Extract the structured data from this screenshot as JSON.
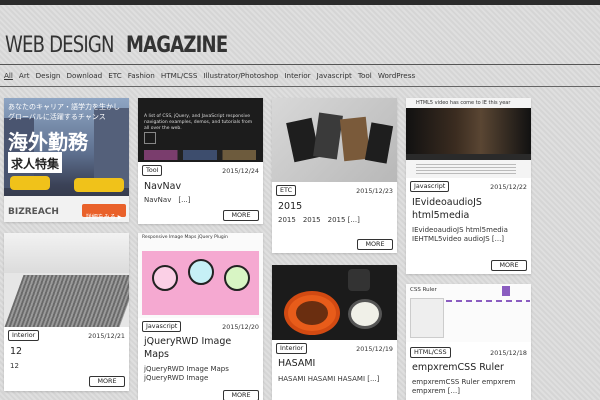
{
  "site": {
    "logo_light": "WEB DESIGN",
    "logo_bold": "MAGAZINE"
  },
  "nav": [
    "All",
    "Art",
    "Design",
    "Download",
    "ETC",
    "Fashion",
    "HTML/CSS",
    "Illustrator/Photoshop",
    "Interior",
    "Javascript",
    "Tool",
    "WordPress"
  ],
  "ad": {
    "line1": "あなたのキャリア・語学力を生かし",
    "line2": "グローバルに活躍するチャンス",
    "headline": "海外勤務",
    "sub": "求人特集",
    "brand": "BIZREACH",
    "cta": "詳細をみる ▶"
  },
  "posts": {
    "navnav": {
      "tag": "Tool",
      "date": "2015/12/24",
      "title": "NavNav",
      "excerpt": "NavNav　[...]",
      "more": "MORE",
      "thumb_text": "A list of CSS, jQuery, and JavaScript responsive navigation examples, demos, and tutorials from all over the web."
    },
    "p2015": {
      "tag": "ETC",
      "date": "2015/12/23",
      "title": "2015",
      "excerpt": "2015　2015　2015 [...]",
      "more": "MORE"
    },
    "iev": {
      "tag": "Javascript",
      "date": "2015/12/22",
      "title": "IEvideoaudioJS html5media",
      "excerpt": "IEvideoaudioJS html5media IEHTML5video audioJS [...]",
      "more": "MORE",
      "thumb_text": "HTML5 video has come to IE this year"
    },
    "p12": {
      "tag": "Interior",
      "date": "2015/12/21",
      "title": "12",
      "excerpt": "12",
      "more": "MORE"
    },
    "jq": {
      "tag": "Javascript",
      "date": "2015/12/20",
      "title": "jQueryRWD Image Maps",
      "excerpt": "jQueryRWD Image Maps jQueryRWD Image",
      "more": "MORE",
      "thumb_text": "Responsive Image Maps jQuery Plugin"
    },
    "hasami": {
      "tag": "Interior",
      "date": "2015/12/19",
      "title": "HASAMI",
      "excerpt": "HASAMI HASAMI HASAMI [...]",
      "more": "MORE"
    },
    "empx": {
      "tag": "HTML/CSS",
      "date": "2015/12/18",
      "title": "empxremCSS Ruler",
      "excerpt": "empxremCSS Ruler empxrem empxrem [...]",
      "thumb_text": "CSS Ruler"
    }
  },
  "colors": {
    "accent_ad": "#e9612a",
    "topbar": "#2b2b2b"
  }
}
